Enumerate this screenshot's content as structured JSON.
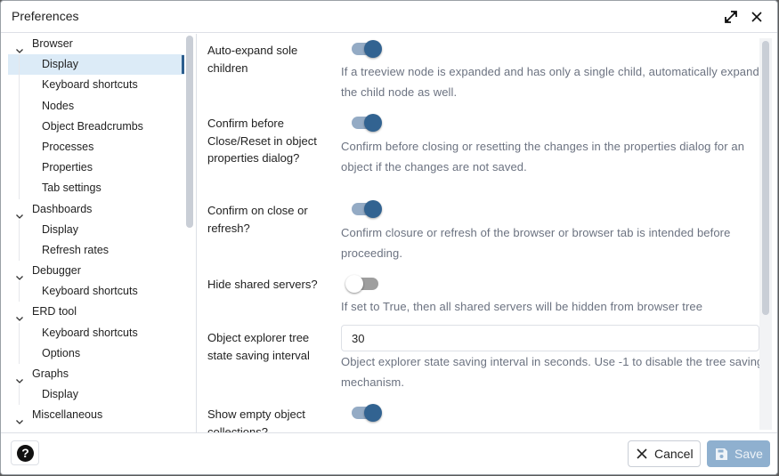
{
  "window": {
    "title": "Preferences",
    "icons": {
      "expand": "expand-arrows-icon",
      "close": "close-icon"
    }
  },
  "sidebar": {
    "groups": [
      {
        "label": "Browser",
        "expanded": true,
        "items": [
          {
            "label": "Display",
            "selected": true
          },
          {
            "label": "Keyboard shortcuts"
          },
          {
            "label": "Nodes"
          },
          {
            "label": "Object Breadcrumbs"
          },
          {
            "label": "Processes"
          },
          {
            "label": "Properties"
          },
          {
            "label": "Tab settings"
          }
        ]
      },
      {
        "label": "Dashboards",
        "expanded": true,
        "items": [
          {
            "label": "Display"
          },
          {
            "label": "Refresh rates"
          }
        ]
      },
      {
        "label": "Debugger",
        "expanded": true,
        "items": [
          {
            "label": "Keyboard shortcuts"
          }
        ]
      },
      {
        "label": "ERD tool",
        "expanded": true,
        "items": [
          {
            "label": "Keyboard shortcuts"
          },
          {
            "label": "Options"
          }
        ]
      },
      {
        "label": "Graphs",
        "expanded": true,
        "items": [
          {
            "label": "Display"
          }
        ]
      },
      {
        "label": "Miscellaneous",
        "expanded": true,
        "items": []
      }
    ]
  },
  "settings": [
    {
      "label": "Auto-expand sole children",
      "type": "toggle",
      "value": true,
      "help": "If a treeview node is expanded and has only a single child, automatically expand the child node as well."
    },
    {
      "label": "Confirm before Close/Reset in object properties dialog?",
      "type": "toggle",
      "value": true,
      "help": "Confirm before closing or resetting the changes in the properties dialog for an object if the changes are not saved."
    },
    {
      "label": "Confirm on close or refresh?",
      "type": "toggle",
      "value": true,
      "help": "Confirm closure or refresh of the browser or browser tab is intended before proceeding."
    },
    {
      "label": "Hide shared servers?",
      "type": "toggle",
      "value": false,
      "help": "If set to True, then all shared servers will be hidden from browser tree"
    },
    {
      "label": "Object explorer tree state saving interval",
      "type": "number",
      "value": "30",
      "help": "Object explorer state saving interval in seconds. Use -1 to disable the tree saving mechanism."
    },
    {
      "label": "Show empty object collections?",
      "type": "toggle",
      "value": true,
      "help": ""
    }
  ],
  "footer": {
    "help_label": "?",
    "cancel_label": "Cancel",
    "save_label": "Save"
  },
  "colors": {
    "accent": "#326391",
    "selected_row": "#dcebf7",
    "save_disabled": "#8fb0cf"
  }
}
